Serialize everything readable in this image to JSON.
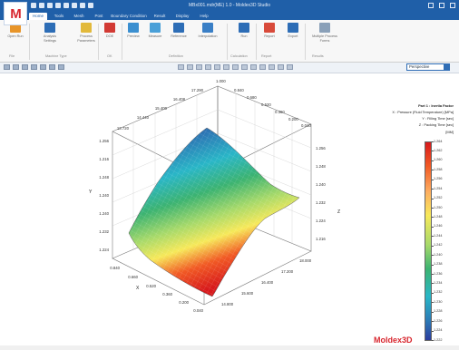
{
  "app": {
    "title": "MBx001.mdr(ME) 1.0 - Moldex3D Studio",
    "logo_text": "M",
    "brand": "Moldex3D"
  },
  "tabs": [
    "Home",
    "Tools",
    "Mesh",
    "Post",
    "Boundary Condition",
    "Result",
    "Display",
    "Help"
  ],
  "ribbon": {
    "buttons": [
      {
        "label": "Open Run",
        "color": "#e8952a"
      },
      {
        "label": "Analysis Settings",
        "color": "#2d6db6"
      },
      {
        "label": "Process Parameters",
        "color": "#e2b93b"
      },
      {
        "label": "DOE",
        "color": "#d23a34"
      },
      {
        "label": "Preview",
        "color": "#3b8fd0"
      },
      {
        "label": "Measure",
        "color": "#4aa0d8"
      },
      {
        "label": "Reference",
        "color": "#2d6db6"
      },
      {
        "label": "Interpolation",
        "color": "#3a7fc6"
      },
      {
        "label": "Run",
        "color": "#2d6db6"
      },
      {
        "label": "Report",
        "color": "#d84a3a"
      },
      {
        "label": "Export",
        "color": "#2d6db6"
      },
      {
        "label": "Multiple Process Forms",
        "color": "#8aa0b8"
      }
    ],
    "groups": [
      "File",
      "Machine Type",
      "OK",
      "Definition",
      "Calculation",
      "Report",
      "Results"
    ]
  },
  "toolbar": {
    "view_select": "Perspective"
  },
  "plot": {
    "axis_labels": {
      "x": "X",
      "y": "Y",
      "z": "Z"
    },
    "top_ticks": [
      "1.000",
      "0.840",
      "0.680",
      "0.520",
      "0.360",
      "0.200",
      "0.040"
    ],
    "topleft_ticks": [
      "17.290",
      "16.408",
      "15.400",
      "14.440",
      "13.720"
    ],
    "left_ticks": [
      "1.256",
      "1.216",
      "1.248",
      "1.240",
      "1.240",
      "1.232",
      "1.224"
    ],
    "bottomleft_ticks": [
      "0.840",
      "0.660",
      "0.520",
      "0.360",
      "0.200",
      "0.040"
    ],
    "right_ticks": [
      "1.256",
      "1.248",
      "1.240",
      "1.232",
      "1.224",
      "1.216"
    ],
    "bottomright_ticks": [
      "18.000",
      "17.200",
      "16.400",
      "15.600",
      "14.800"
    ]
  },
  "legend": {
    "title": "Part 1 : Inertia Factor",
    "lines": [
      "X : Pressure (Fluid Temperature) [MPa]",
      "Y : Filling Time [sec]",
      "Z : Packing Time [sec]",
      "[MM]"
    ],
    "labels": [
      "1.264",
      "1.262",
      "1.260",
      "1.258",
      "1.256",
      "1.254",
      "1.252",
      "1.250",
      "1.248",
      "1.246",
      "1.244",
      "1.242",
      "1.240",
      "1.238",
      "1.236",
      "1.234",
      "1.232",
      "1.230",
      "1.228",
      "1.226",
      "1.224",
      "1.222"
    ]
  }
}
